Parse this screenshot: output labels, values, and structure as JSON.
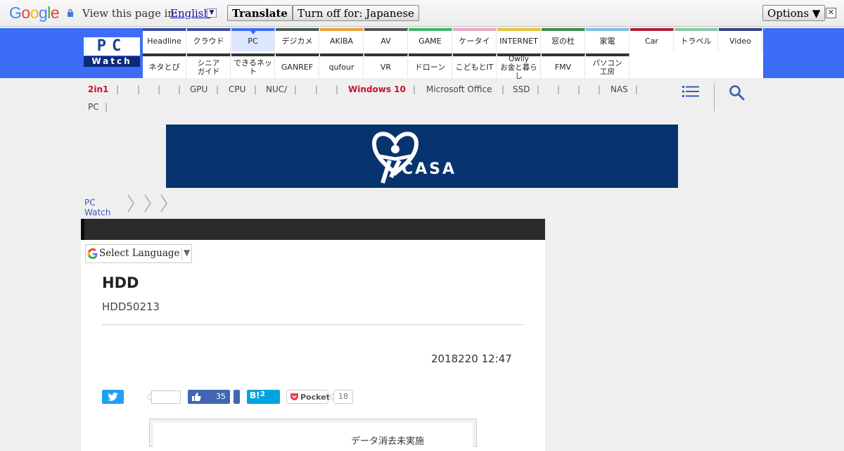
{
  "translate_bar": {
    "logo": "Google",
    "view_label": "View this page in:",
    "language": "English",
    "translate_button": "Translate",
    "turn_off_button": "Turn off for: Japanese",
    "options_button": "Options ▼",
    "close": "✕"
  },
  "site": {
    "logo_top": "PC",
    "logo_bottom": "Watch"
  },
  "nav": {
    "row1": [
      {
        "label": "Headline",
        "color": "#3b4da6"
      },
      {
        "label": "クラウド",
        "color": "#3b4da6"
      },
      {
        "label": "PC",
        "color": "#3b6df6",
        "active": true
      },
      {
        "label": "デジカメ",
        "color": "#4a5a57"
      },
      {
        "label": "AKIBA",
        "color": "#e8a33a"
      },
      {
        "label": "AV",
        "color": "#555555"
      },
      {
        "label": "GAME",
        "color": "#3cb66a"
      },
      {
        "label": "ケータイ",
        "color": "#e9a7c6"
      },
      {
        "label": "INTERNET",
        "color": "#e9c23a"
      },
      {
        "label": "窓の杜",
        "color": "#3c8c4a"
      },
      {
        "label": "家電",
        "color": "#79c0e0"
      },
      {
        "label": "Car",
        "color": "#b5203a"
      },
      {
        "label": "トラベル",
        "color": "#86c7a6"
      },
      {
        "label": "Video",
        "color": "#36428a"
      }
    ],
    "row2": [
      {
        "label": "ネタとぴ"
      },
      {
        "label": "シニア\nガイド"
      },
      {
        "label": "できるネット"
      },
      {
        "label": "GANREF"
      },
      {
        "label": "qufour"
      },
      {
        "label": "VR"
      },
      {
        "label": "ドローン"
      },
      {
        "label": "こどもとIT"
      },
      {
        "label": "Owlly\nお金と暮らし"
      },
      {
        "label": "FMV"
      },
      {
        "label": "パソコン\n工房"
      }
    ]
  },
  "subnav": {
    "items": [
      "2in1",
      "GPU",
      "CPU",
      "NUC/",
      "Windows 10",
      "Microsoft Office",
      "SSD",
      "NAS",
      "PC"
    ]
  },
  "banner": {
    "brand": "CASA",
    "color": "#07346e"
  },
  "breadcrumb": {
    "home": "PC Watch"
  },
  "language_select": {
    "label": "Select Language"
  },
  "article": {
    "title": "HDD",
    "subtitle": "HDD50213",
    "date": "2018220 12:47",
    "image_caption": "データ消去未実施"
  },
  "social": {
    "like_count": "35",
    "hatena_label": "B!",
    "hatena_count": "2",
    "pocket_label": "Pocket",
    "pocket_count": "18"
  },
  "colors": {
    "nav_blue": "#3b6df6",
    "red_link": "#c8102e",
    "twitter": "#1da1f2",
    "facebook": "#4267b2",
    "hatena": "#00a4de"
  }
}
